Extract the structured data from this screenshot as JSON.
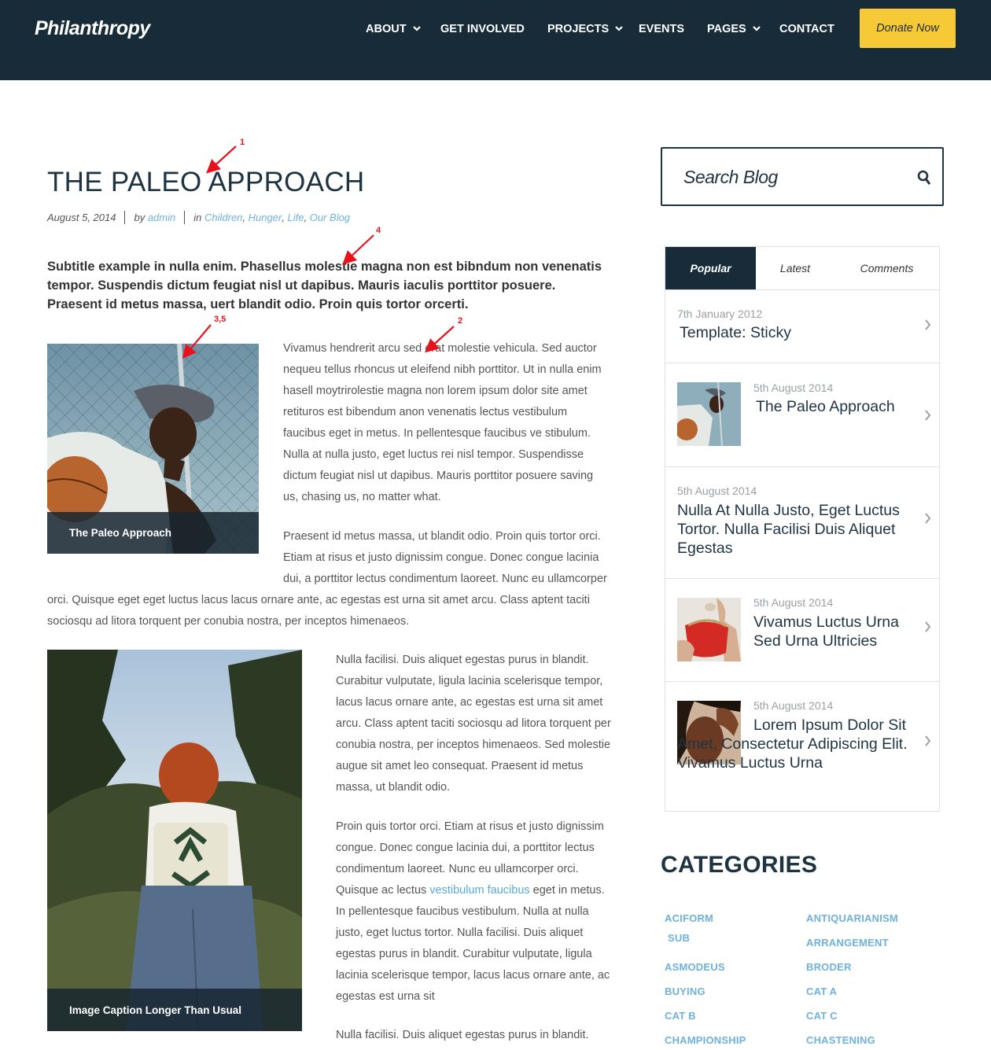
{
  "header": {
    "logo": "Philanthropy",
    "nav": [
      {
        "label": "ABOUT",
        "dropdown": true
      },
      {
        "label": "GET INVOLVED",
        "dropdown": false
      },
      {
        "label": "PROJECTS",
        "dropdown": true
      },
      {
        "label": "EVENTS",
        "dropdown": false
      },
      {
        "label": "PAGES",
        "dropdown": true
      },
      {
        "label": "CONTACT",
        "dropdown": false
      }
    ],
    "donate_label": "Donate Now"
  },
  "post": {
    "title": "THE PALEO APPROACH",
    "date": "August 5, 2014",
    "by_label": "by",
    "author": "admin",
    "in_label": "in",
    "categories": [
      "Children",
      "Hunger",
      "Life",
      "Our Blog"
    ],
    "subtitle": "Subtitle example in nulla enim. Phasellus molestie magna non est bibndum non venenatis tempor. Suspendis dictum feugiat nisl ut dapibus. Mauris iaculis porttitor posuere. Praesent id metus massa, uert blandit odio. Proin quis tortor orcerti.",
    "figure1_caption": "The Paleo Approach",
    "figure2_caption": "Image Caption Longer Than Usual",
    "p1": "Vivamus hendrerit arcu sed erat molestie vehicula. Sed auctor nequeu tellus rhoncus ut eleifend nibh porttitor. Ut in nulla enim hasell moytrirolestie magna non lorem ipsum dolor site amet retituros est bibendum anon venenatis lectus vestibulum faucibus eget in metus. In pellentesque faucibus ve stibulum. Nulla at nulla justo, eget luctus rei nisl tempor. Suspendisse dictum feugiat nisl ut dapibus. Mauris porttitor posuere saving us, chasing us, no matter what.",
    "p2": "Praesent id metus massa, ut blandit odio. Proin quis tortor orci. Etiam at risus et justo dignissim congue. Donec congue lacinia dui, a porttitor lectus condimentum laoreet. Nunc eu ullamcorper orci. Quisque eget eget luctus lacus lacus ornare ante, ac egestas est urna sit amet arcu. Class aptent taciti sociosqu ad litora torquent per conubia nostra, per inceptos himenaeos.",
    "p3": "Nulla facilisi. Duis aliquet egestas purus in blandit. Curabitur vulputate, ligula lacinia scelerisque tempor, lacus lacus ornare ante, ac egestas est urna sit amet arcu. Class aptent taciti sociosqu ad litora torquent per conubia nostra, per inceptos himenaeos. Sed molestie augue sit amet leo consequat. Praesent id metus massa, ut blandit odio.",
    "p4_before": "Proin quis tortor orci. Etiam at risus et justo dignissim congue. Donec congue lacinia dui, a porttitor lectus condimentum laoreet. Nunc eu ullamcorper orci. Quisque ac lectus",
    "p4_link": "vestibulum faucibus",
    "p4_after": "eget in metus. In pellentesque faucibus vestibulum. Nulla at nulla justo, eget luctus tortor. Nulla facilisi. Duis aliquet egestas purus in blandit. Curabitur vulputate, ligula lacinia scelerisque tempor, lacus lacus ornare ante, ac egestas est urna sit",
    "p5": "Nulla facilisi. Duis aliquet egestas purus in blandit."
  },
  "annotations": [
    "1",
    "4",
    "3,5",
    "2"
  ],
  "sidebar": {
    "search_placeholder": "Search Blog",
    "tabs": [
      "Popular",
      "Latest",
      "Comments"
    ],
    "active_tab": "Popular",
    "popular": [
      {
        "date": "7th January 2012",
        "title": "Template: Sticky",
        "thumb": "none"
      },
      {
        "date": "5th August 2014",
        "title": "The Paleo Approach",
        "thumb": "basketball-player"
      },
      {
        "date": "5th August 2014",
        "title": "Nulla At Nulla Justo, Eget Luctus Tortor. Nulla Facilisi Duis Aliquet Egestas",
        "thumb": "none"
      },
      {
        "date": "5th August 2014",
        "title": "Vivamus Luctus Urna Sed Urna Ultricies",
        "thumb": "red-purse"
      },
      {
        "date": "5th August 2014",
        "title": "Lorem Ipsum Dolor Sit Amet, Consectetur Adipiscing Elit. Vivamus Luctus Urna",
        "thumb": "portrait"
      }
    ],
    "categories_title": "CATEGORIES",
    "categories_left": [
      "ACIFORM",
      "SUB",
      "ASMODEUS",
      "BUYING",
      "CAT B",
      "CHAMPIONSHIP"
    ],
    "categories_right": [
      "ANTIQUARIANISM",
      "ARRANGEMENT",
      "BRODER",
      "CAT A",
      "CAT C",
      "CHASTENING"
    ]
  },
  "colors": {
    "header_bg": "#172b39",
    "donate_bg": "#f6c936",
    "link": "#6fb1dd",
    "heading": "#1f3442",
    "annotation": "#e8121c"
  }
}
